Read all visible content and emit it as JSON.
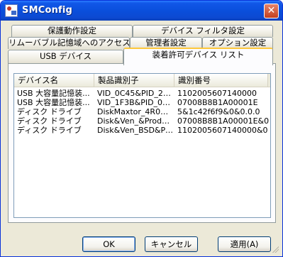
{
  "window": {
    "title": "SMConfig",
    "close_glyph": "✕"
  },
  "tabs": {
    "row1": [
      "保護動作設定",
      "デバイス フィルタ設定"
    ],
    "row2": [
      "リムーバブル記憶域へのアクセス",
      "管理者設定",
      "オプション設定"
    ],
    "row3": [
      "USB デバイス",
      "装着許可デバイス リスト"
    ],
    "active": "装着許可デバイス リスト"
  },
  "list": {
    "columns": [
      "デバイス名",
      "製品識別子",
      "識別番号"
    ],
    "rows": [
      [
        "USB 大容量記憶装...",
        "VID_0C45&PID_20...",
        "1102005607140000"
      ],
      [
        "USB 大容量記憶装...",
        "VID_1F3B&PID_00...",
        "07008B8B1A00001E"
      ],
      [
        "ディスク ドライブ",
        "DiskMaxtor_4R080...",
        "5&1c42f6f9&0&0.0.0"
      ],
      [
        "ディスク ドライブ",
        "Disk&Ven_&Prod_...",
        "07008B8B1A00001E&0"
      ],
      [
        "ディスク ドライブ",
        "Disk&Ven_BSD&Pr...",
        "1102005607140000&0"
      ]
    ]
  },
  "buttons": {
    "ok": "OK",
    "cancel": "キャンセル",
    "apply": "適用(A)"
  }
}
